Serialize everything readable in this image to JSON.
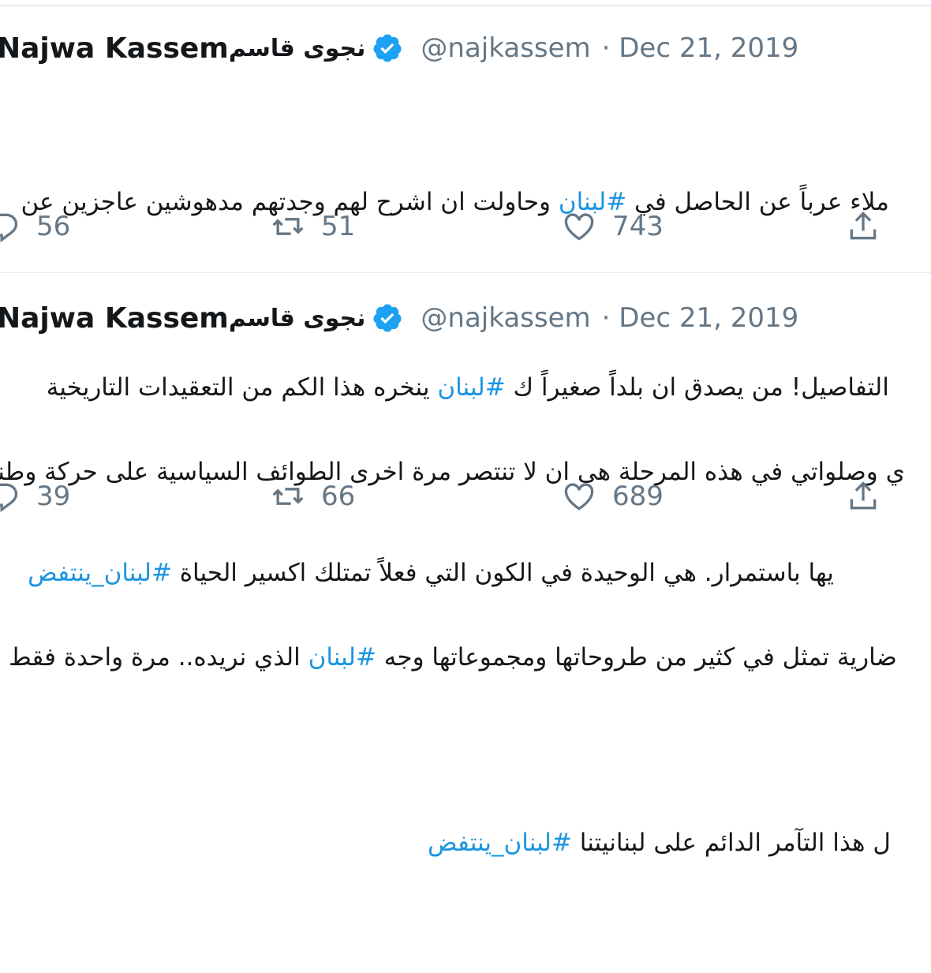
{
  "tweets": [
    {
      "author_name_en": "Najwa Kassem",
      "author_name_ar": "نجوى قاسم",
      "handle": "@najkassem",
      "date": "· Dec 21, 2019",
      "lines": [
        {
          "before": "ملاء عرباً عن الحاصل في ",
          "tag": "#لبنان",
          "after": " وحاولت ان اشرح لهم وجدتهم مدهوشين عاجزين عن"
        },
        {
          "before": "التفاصيل! من يصدق ان بلداً صغيراً ك ",
          "tag": "#لبنان",
          "after": " ينخره هذا الكم من التعقيدات التاريخية"
        },
        {
          "before": "يها باستمرار. هي الوحيدة في الكون التي فعلاً تمتلك اكسير الحياة ",
          "tag": "#لبنان_ينتفض",
          "after": ""
        }
      ],
      "replies": "56",
      "retweets": "51",
      "likes": "743"
    },
    {
      "author_name_en": "Najwa Kassem",
      "author_name_ar": "نجوى قاسم",
      "handle": "@najkassem",
      "date": "· Dec 21, 2019",
      "lines": [
        {
          "before": "ي وصلواتي في هذه المرحلة هي ان لا تنتصر مرة اخرى الطوائف السياسية على حركة وطنية",
          "tag": "",
          "after": ""
        },
        {
          "before": "ضارية تمثل في كثير من طروحاتها ومجموعاتها وجه ",
          "tag": "#لبنان",
          "after": " الذي نريده.. مرة واحدة فقط"
        },
        {
          "before": "ل هذا التآمر الدائم على لبنانيتنا ",
          "tag": "#لبنان_ينتفض",
          "after": ""
        }
      ],
      "replies": "39",
      "retweets": "66",
      "likes": "689"
    }
  ],
  "icons": {
    "reply": "reply-icon",
    "retweet": "retweet-icon",
    "like": "heart-icon",
    "share": "share-icon",
    "verified": "verified-badge-icon"
  },
  "colors": {
    "hashtag": "#1b95e0",
    "meta": "#657786",
    "verified": "#1da1f2"
  }
}
